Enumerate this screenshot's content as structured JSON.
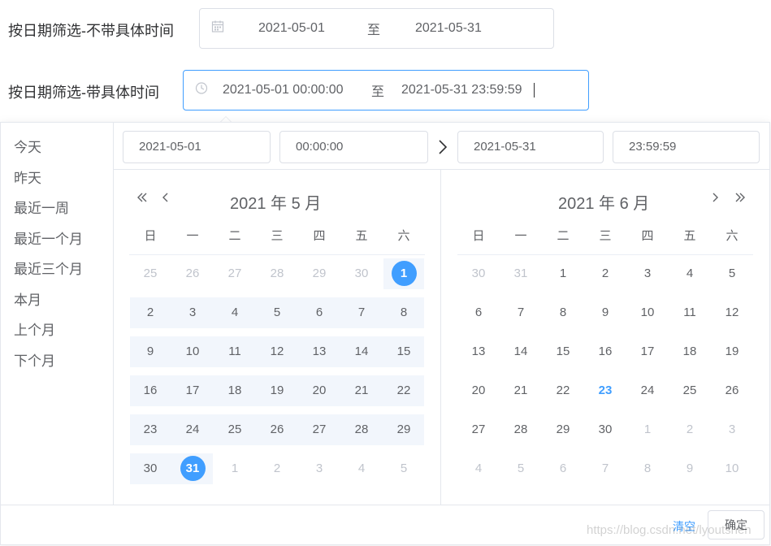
{
  "filter1": {
    "label": "按日期筛选-不带具体时间",
    "start": "2021-05-01",
    "separator": "至",
    "end": "2021-05-31",
    "icon": "calendar-icon"
  },
  "filter2": {
    "label": "按日期筛选-带具体时间",
    "start": "2021-05-01 00:00:00",
    "separator": "至",
    "end": "2021-05-31 23:59:59",
    "icon": "clock-icon"
  },
  "picker": {
    "shortcuts": [
      "今天",
      "昨天",
      "最近一周",
      "最近一个月",
      "最近三个月",
      "本月",
      "上个月",
      "下个月"
    ],
    "start_date": "2021-05-01",
    "start_time": "00:00:00",
    "end_date": "2021-05-31",
    "end_time": "23:59:59",
    "weekdays": [
      "日",
      "一",
      "二",
      "三",
      "四",
      "五",
      "六"
    ],
    "left_title": "2021 年 5 月",
    "right_title": "2021 年 6 月",
    "clear_label": "清空",
    "ok_label": "确定",
    "accent_color": "#409eff"
  },
  "watermark": "https://blog.csdn.net/lyoutshen"
}
